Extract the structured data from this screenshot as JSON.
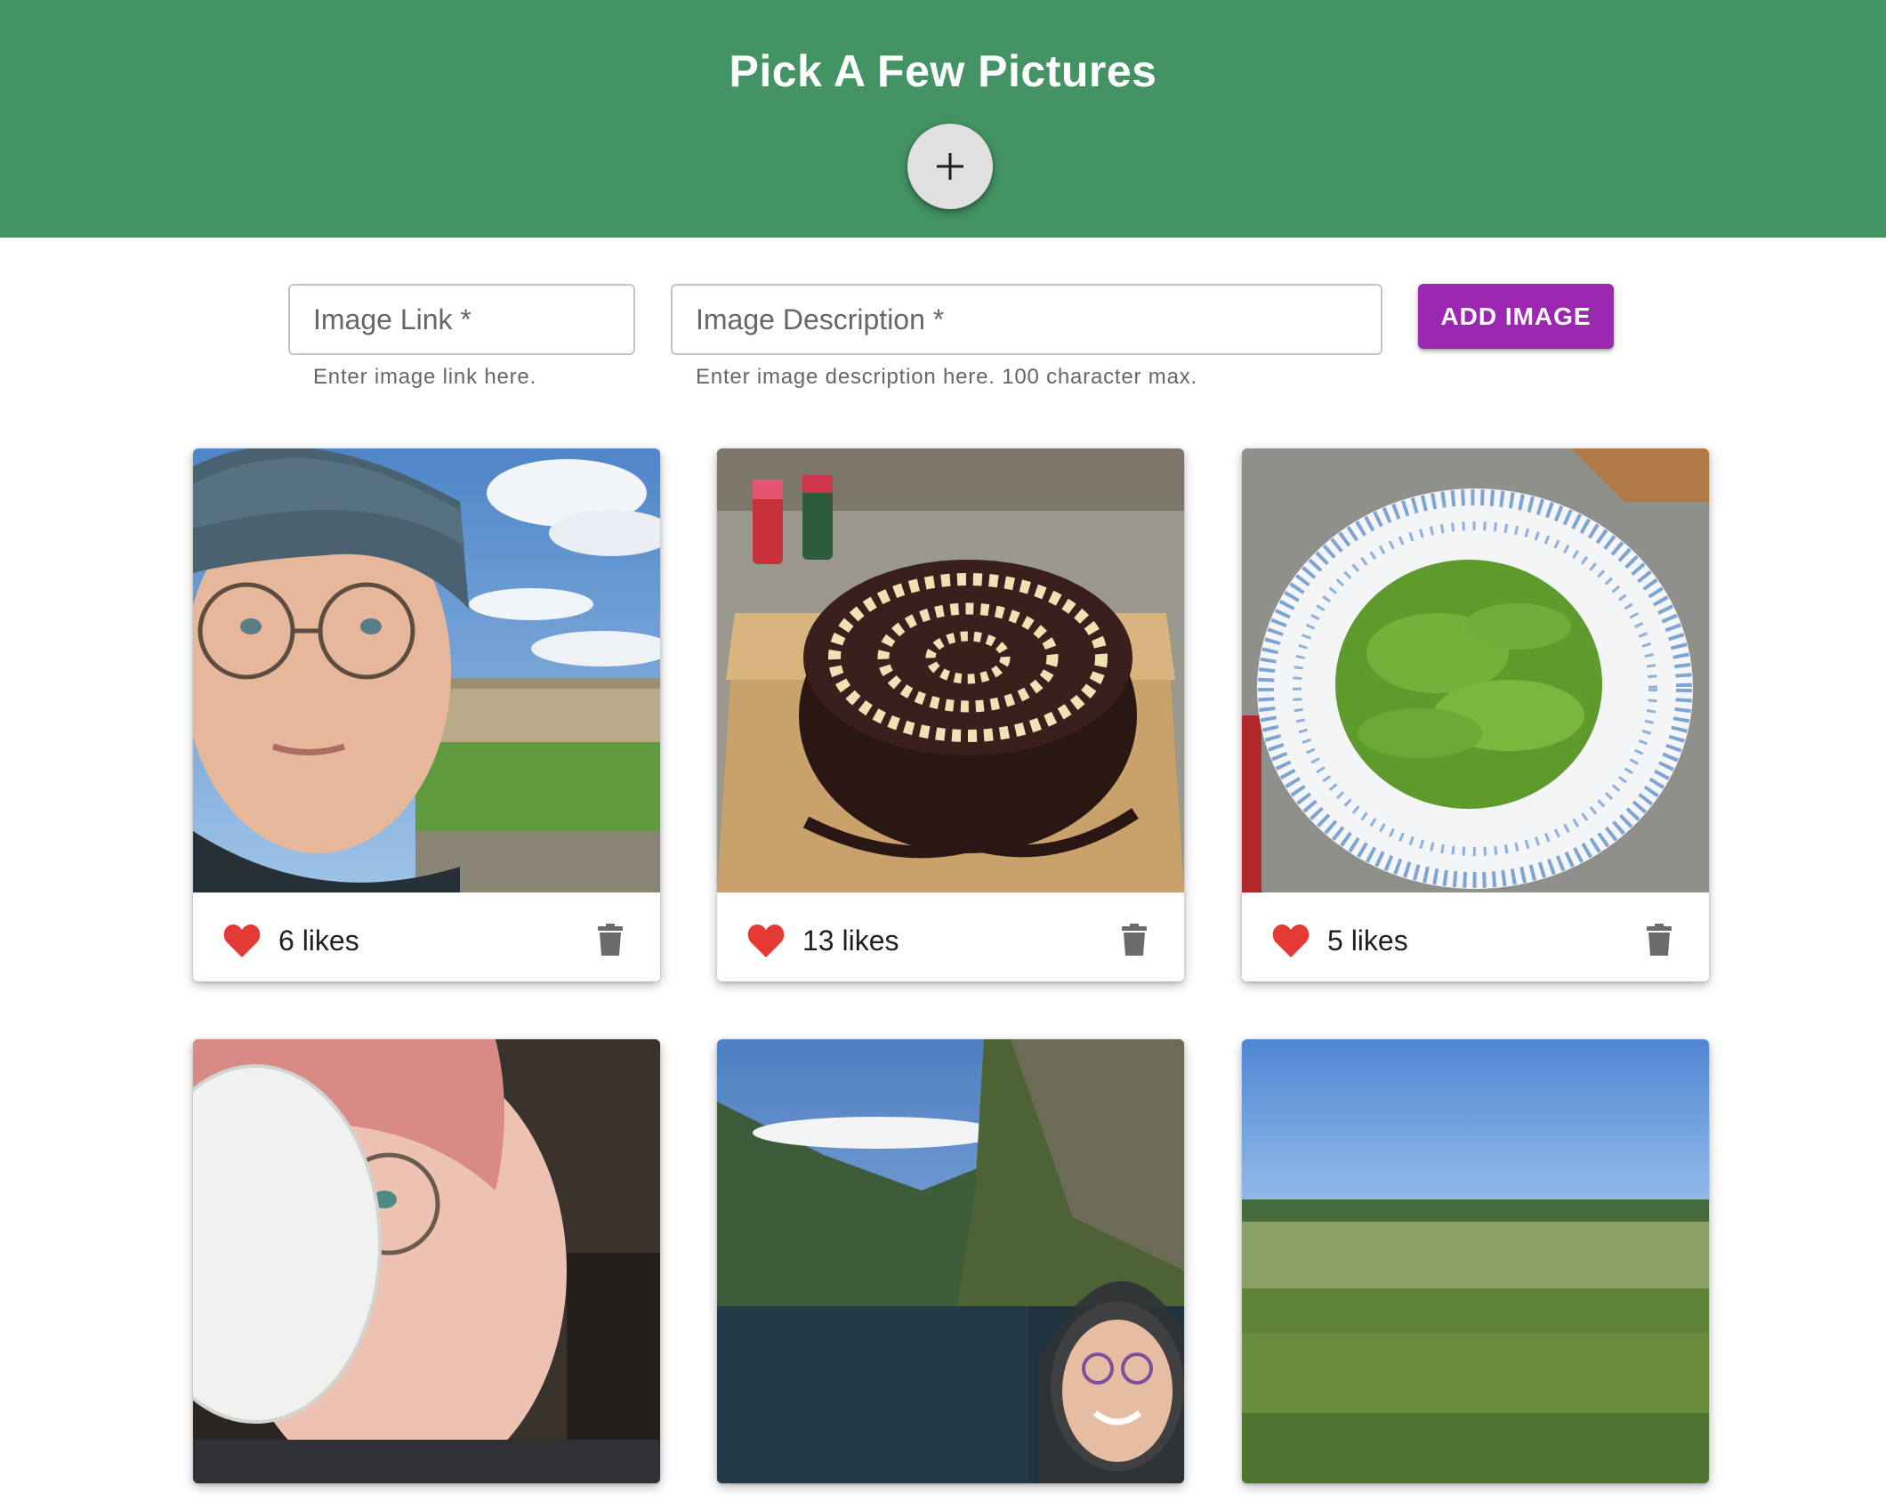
{
  "header": {
    "title": "Pick A Few Pictures",
    "add_toggle_icon": "plus-icon",
    "background_color": "#449364"
  },
  "form": {
    "image_link": {
      "placeholder": "Image Link *",
      "value": "",
      "helper": "Enter image link here."
    },
    "image_description": {
      "placeholder": "Image Description *",
      "value": "",
      "helper": "Enter image description here. 100 character max."
    },
    "submit_label": "ADD IMAGE",
    "submit_color": "#9c27b0"
  },
  "cards": [
    {
      "photo": "cyclist-selfie",
      "likes_label": "6 likes",
      "like_icon": "heart-icon",
      "delete_icon": "trash-icon"
    },
    {
      "photo": "chocolate-cake",
      "likes_label": "13 likes",
      "like_icon": "heart-icon",
      "delete_icon": "trash-icon"
    },
    {
      "photo": "edamame-bowl",
      "likes_label": "5 likes",
      "like_icon": "heart-icon",
      "delete_icon": "trash-icon"
    },
    {
      "photo": "coffee-selfie",
      "likes_label": "",
      "like_icon": "heart-icon",
      "delete_icon": "trash-icon"
    },
    {
      "photo": "fjord-selfie",
      "likes_label": "",
      "like_icon": "heart-icon",
      "delete_icon": "trash-icon"
    },
    {
      "photo": "prairie-field",
      "likes_label": "",
      "like_icon": "heart-icon",
      "delete_icon": "trash-icon"
    }
  ],
  "colors": {
    "heart": "#e53935",
    "trash": "#6b6b6b"
  }
}
